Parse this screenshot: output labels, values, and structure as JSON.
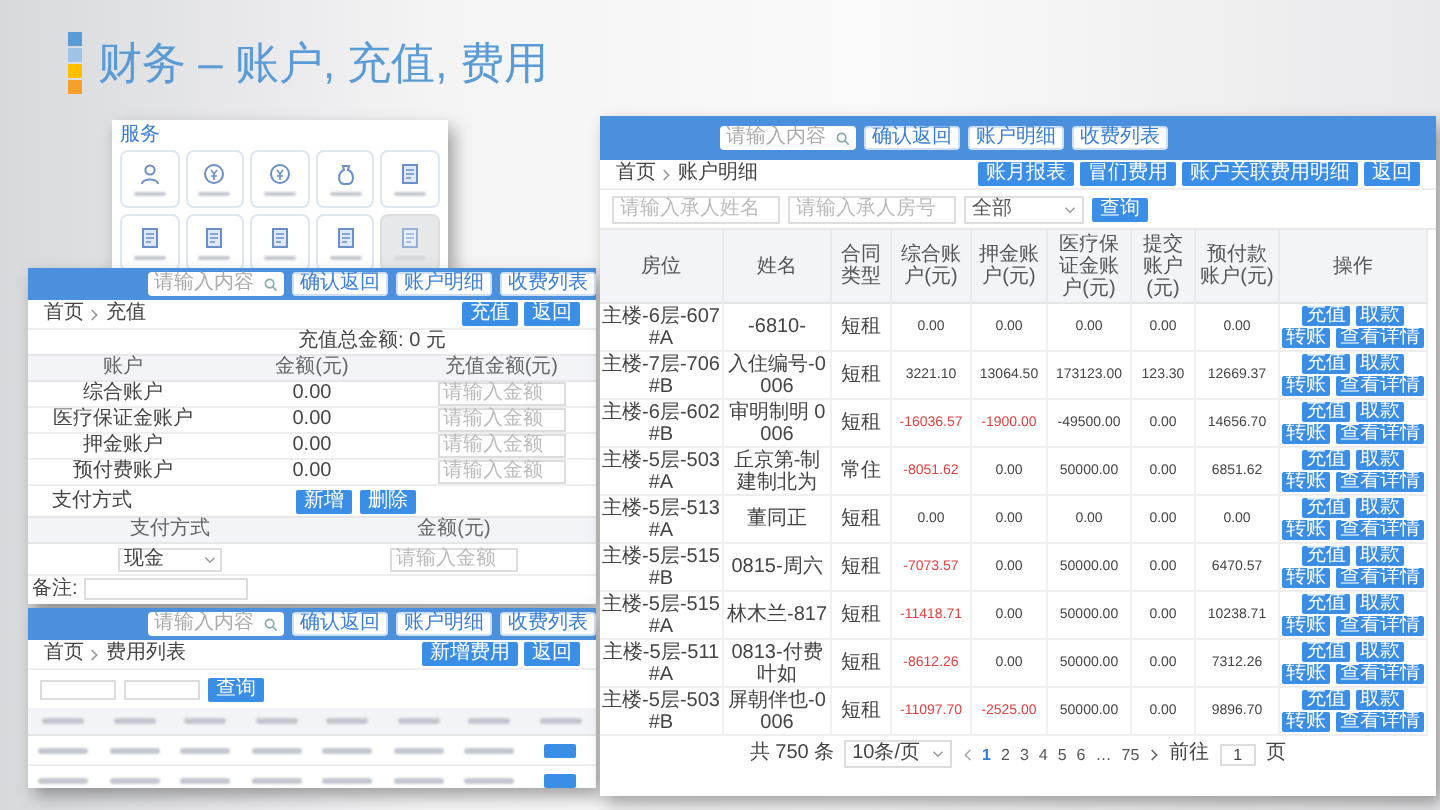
{
  "title": "财务 – 账户, 充值, 费用",
  "service_panel": {
    "title": "服务",
    "tiles": [
      {
        "kind": "person",
        "disabled": false
      },
      {
        "kind": "coin",
        "disabled": false
      },
      {
        "kind": "coin",
        "disabled": false
      },
      {
        "kind": "bag",
        "disabled": false
      },
      {
        "kind": "document",
        "disabled": false
      },
      {
        "kind": "document",
        "disabled": false
      },
      {
        "kind": "document",
        "disabled": false
      },
      {
        "kind": "document",
        "disabled": false
      },
      {
        "kind": "document",
        "disabled": false
      },
      {
        "kind": "document",
        "disabled": true
      }
    ]
  },
  "recharge_window": {
    "top_bar": {
      "search_placeholder": "请输入内容",
      "buttons": [
        "确认返回",
        "账户明细",
        "收费列表"
      ]
    },
    "breadcrumb": [
      "首页",
      "充值"
    ],
    "actions": [
      "充值",
      "返回"
    ],
    "total": "充值总金额: 0 元",
    "columns": [
      "账户",
      "金额(元)",
      "充值金额(元)"
    ],
    "rows": [
      {
        "account": "综合账户",
        "amount": "0.00",
        "placeholder": "请输入金额"
      },
      {
        "account": "医疗保证金账户",
        "amount": "0.00",
        "placeholder": "请输入金额"
      },
      {
        "account": "押金账户",
        "amount": "0.00",
        "placeholder": "请输入金额"
      },
      {
        "account": "预付费账户",
        "amount": "0.00",
        "placeholder": "请输入金额"
      }
    ],
    "payment": {
      "title": "支付方式",
      "buttons": [
        "新增",
        "删除"
      ],
      "columns": [
        "支付方式",
        "金额(元)"
      ],
      "method": "现金",
      "placeholder": "请输入金额"
    },
    "remark_label": "备注:"
  },
  "fee_window": {
    "top_bar": {
      "search_placeholder": "请输入内容",
      "buttons": [
        "确认返回",
        "账户明细",
        "收费列表"
      ]
    },
    "breadcrumb": [
      "首页",
      "费用列表"
    ],
    "actions": [
      "新增费用",
      "返回"
    ],
    "search_button": "查询"
  },
  "account_window": {
    "top_bar": {
      "search_placeholder": "请输入内容",
      "buttons": [
        "确认返回",
        "账户明细",
        "收费列表"
      ]
    },
    "breadcrumb": [
      "首页",
      "账户明细"
    ],
    "actions": [
      "账月报表",
      "冒们费用",
      "账户关联费用明细",
      "返回"
    ],
    "filters": {
      "name_placeholder": "请输入承人姓名",
      "room_placeholder": "请输入承人房号",
      "select": "全部",
      "search_button": "查询"
    },
    "columns": [
      "房位",
      "姓名",
      "合同类型",
      "综合账户(元)",
      "押金账户(元)",
      "医疗保证金账户(元)",
      "提交账户(元)",
      "预付款账户(元)",
      "操作"
    ],
    "rows": [
      {
        "room": "主楼-6层-607#A",
        "name": "-6810-",
        "contract": "短租",
        "balances": [
          {
            "value": "0.00",
            "negative": false
          },
          {
            "value": "0.00",
            "negative": false
          },
          {
            "value": "0.00",
            "negative": false
          },
          {
            "value": "0.00",
            "negative": false
          },
          {
            "value": "0.00",
            "negative": false
          }
        ],
        "actions": [
          "充值",
          "取款",
          "转账",
          "查看详情"
        ]
      },
      {
        "room": "主楼-7层-706#B",
        "name": "入住编号-0006",
        "contract": "短租",
        "balances": [
          {
            "value": "3221.10",
            "negative": false
          },
          {
            "value": "13064.50",
            "negative": false
          },
          {
            "value": "173123.00",
            "negative": false
          },
          {
            "value": "123.30",
            "negative": false
          },
          {
            "value": "12669.37",
            "negative": false
          }
        ],
        "actions": [
          "充值",
          "取款",
          "转账",
          "查看详情"
        ]
      },
      {
        "room": "主楼-6层-602#B",
        "name": "审明制明 0006",
        "contract": "短租",
        "balances": [
          {
            "value": "-16036.57",
            "negative": true
          },
          {
            "value": "-1900.00",
            "negative": true
          },
          {
            "value": "-49500.00",
            "negative": false
          },
          {
            "value": "0.00",
            "negative": false
          },
          {
            "value": "14656.70",
            "negative": false
          }
        ],
        "actions": [
          "充值",
          "取款",
          "转账",
          "查看详情"
        ]
      },
      {
        "room": "主楼-5层-503#A",
        "name": "丘京第-制建制北为",
        "contract": "常住",
        "balances": [
          {
            "value": "-8051.62",
            "negative": true
          },
          {
            "value": "0.00",
            "negative": false
          },
          {
            "value": "50000.00",
            "negative": false
          },
          {
            "value": "0.00",
            "negative": false
          },
          {
            "value": "6851.62",
            "negative": false
          }
        ],
        "actions": [
          "充值",
          "取款",
          "转账",
          "查看详情"
        ]
      },
      {
        "room": "主楼-5层-513#A",
        "name": "董同正",
        "contract": "短租",
        "balances": [
          {
            "value": "0.00",
            "negative": false
          },
          {
            "value": "0.00",
            "negative": false
          },
          {
            "value": "0.00",
            "negative": false
          },
          {
            "value": "0.00",
            "negative": false
          },
          {
            "value": "0.00",
            "negative": false
          }
        ],
        "actions": [
          "充值",
          "取款",
          "转账",
          "查看详情"
        ]
      },
      {
        "room": "主楼-5层-515#B",
        "name": "0815-周六",
        "contract": "短租",
        "balances": [
          {
            "value": "-7073.57",
            "negative": true
          },
          {
            "value": "0.00",
            "negative": false
          },
          {
            "value": "50000.00",
            "negative": false
          },
          {
            "value": "0.00",
            "negative": false
          },
          {
            "value": "6470.57",
            "negative": false
          }
        ],
        "actions": [
          "充值",
          "取款",
          "转账",
          "查看详情"
        ]
      },
      {
        "room": "主楼-5层-515#A",
        "name": "林木兰-817",
        "contract": "短租",
        "balances": [
          {
            "value": "-11418.71",
            "negative": true
          },
          {
            "value": "0.00",
            "negative": false
          },
          {
            "value": "50000.00",
            "negative": false
          },
          {
            "value": "0.00",
            "negative": false
          },
          {
            "value": "10238.71",
            "negative": false
          }
        ],
        "actions": [
          "充值",
          "取款",
          "转账",
          "查看详情"
        ]
      },
      {
        "room": "主楼-5层-511#A",
        "name": "0813-付费叶如",
        "contract": "短租",
        "balances": [
          {
            "value": "-8612.26",
            "negative": true
          },
          {
            "value": "0.00",
            "negative": false
          },
          {
            "value": "50000.00",
            "negative": false
          },
          {
            "value": "0.00",
            "negative": false
          },
          {
            "value": "7312.26",
            "negative": false
          }
        ],
        "actions": [
          "充值",
          "取款",
          "转账",
          "查看详情"
        ]
      },
      {
        "room": "主楼-5层-503#B",
        "name": "屏朝伴也-0006",
        "contract": "短租",
        "balances": [
          {
            "value": "-11097.70",
            "negative": true
          },
          {
            "value": "-2525.00",
            "negative": true
          },
          {
            "value": "50000.00",
            "negative": false
          },
          {
            "value": "0.00",
            "negative": false
          },
          {
            "value": "9896.70",
            "negative": false
          }
        ],
        "actions": [
          "充值",
          "取款",
          "转账",
          "查看详情"
        ]
      }
    ],
    "pagination": {
      "total": "共 750 条",
      "page_size": "10条/页",
      "pages": [
        {
          "label": "1",
          "selected": true
        },
        {
          "label": "2",
          "selected": false
        },
        {
          "label": "3",
          "selected": false
        },
        {
          "label": "4",
          "selected": false
        },
        {
          "label": "5",
          "selected": false
        },
        {
          "label": "6",
          "selected": false
        },
        {
          "label": "…",
          "selected": false
        },
        {
          "label": "75",
          "selected": false
        }
      ],
      "goto_label": "前往",
      "goto_value": "1",
      "page_unit": "页"
    }
  }
}
